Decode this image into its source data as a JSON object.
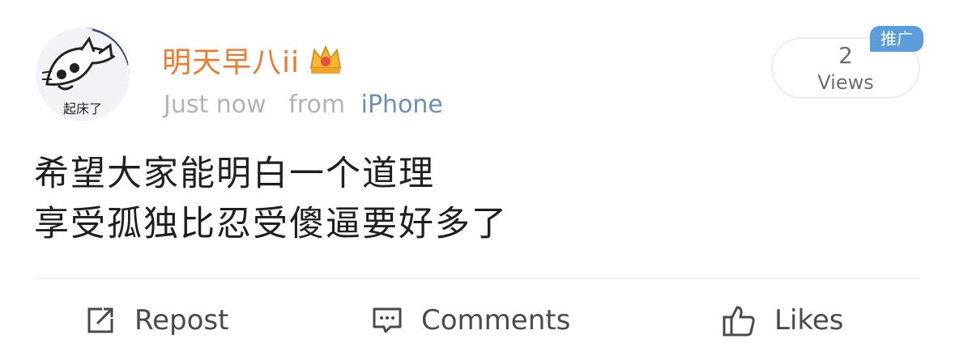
{
  "post": {
    "username": "明天早八ii",
    "timestamp": "Just now",
    "source_prefix": "from",
    "source_device": "iPhone",
    "views_count": "2",
    "views_label": "Views",
    "promo_badge": "推广",
    "content_lines": [
      "希望大家能明白一个道理",
      "享受孤独比忍受傻逼要好多了"
    ],
    "avatar_caption": "起床了"
  },
  "actions": {
    "repost_label": "Repost",
    "comments_label": "Comments",
    "likes_label": "Likes"
  },
  "icons": {
    "verified_badge": "crown-icon",
    "repost": "repost-icon",
    "comments": "comment-icon",
    "likes": "thumbs-up-icon"
  },
  "colors": {
    "username": "#f2792c",
    "source_device": "#6c8fb6",
    "meta_text": "#b3b3b3",
    "badge_bg": "#5b9ddb",
    "body_text": "#1f1f1f",
    "action_text": "#4a4a4a"
  }
}
